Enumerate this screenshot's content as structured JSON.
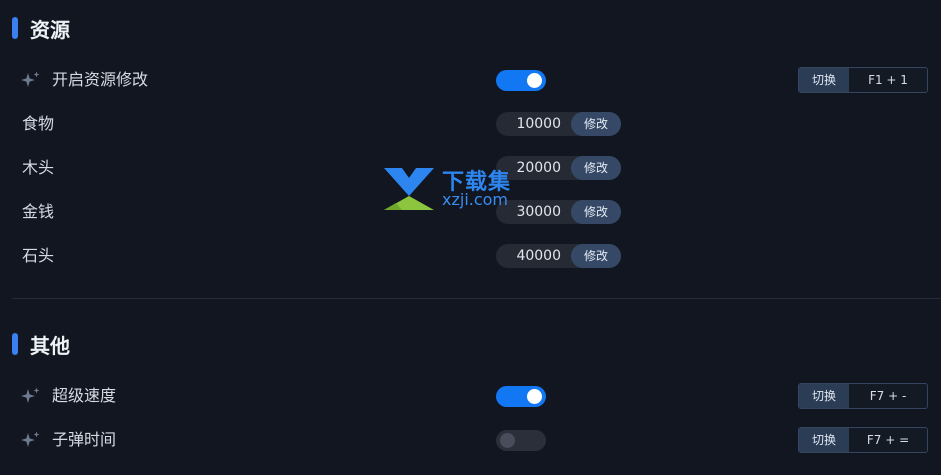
{
  "sections": [
    {
      "title": "资源"
    },
    {
      "title": "其他"
    }
  ],
  "resources": {
    "enable": {
      "label": "开启资源修改",
      "on": true,
      "switch_label": "切换",
      "hotkey": "F1 + 1"
    },
    "items": [
      {
        "label": "食物",
        "value": "10000",
        "edit_label": "修改"
      },
      {
        "label": "木头",
        "value": "20000",
        "edit_label": "修改"
      },
      {
        "label": "金钱",
        "value": "30000",
        "edit_label": "修改"
      },
      {
        "label": "石头",
        "value": "40000",
        "edit_label": "修改"
      }
    ]
  },
  "other": {
    "items": [
      {
        "label": "超级速度",
        "on": true,
        "switch_label": "切换",
        "hotkey": "F7 + -"
      },
      {
        "label": "子弹时间",
        "on": false,
        "switch_label": "切换",
        "hotkey": "F7 + ="
      }
    ]
  },
  "watermark": {
    "name": "下载集",
    "url": "xzji.com"
  },
  "colors": {
    "background": "#111620",
    "accent": "#3b7ff0",
    "toggle_on": "#1277f3",
    "toggle_off": "#2a2f3a",
    "edit_button": "#354966",
    "watermark_green": "#8cc63f",
    "watermark_blue": "#2d86f0"
  },
  "icons": {
    "feature": "sparkle-icon"
  }
}
